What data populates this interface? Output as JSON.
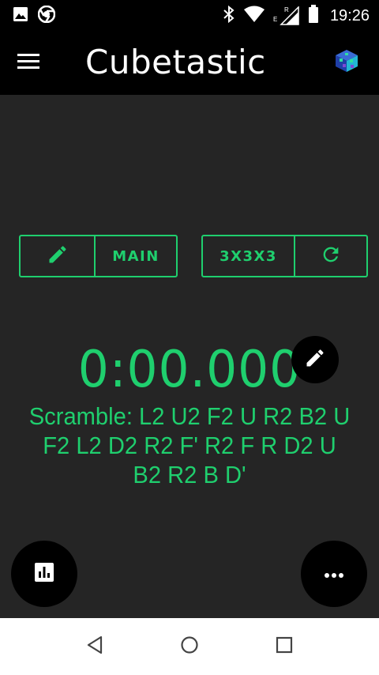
{
  "status_bar": {
    "time": "19:26",
    "icons": [
      "image-icon",
      "chrome-icon",
      "bluetooth-icon",
      "wifi-icon",
      "signal-icon",
      "battery-icon"
    ],
    "network_label_e": "E",
    "network_label_r": "R"
  },
  "app_bar": {
    "title": "Cubetastic",
    "menu_icon": "hamburger-menu-icon",
    "logo_icon": "cube-logo-icon"
  },
  "controls": {
    "session_label": "MAIN",
    "puzzle_label": "3X3X3",
    "edit_icon": "pencil-icon",
    "refresh_icon": "refresh-icon"
  },
  "timer": {
    "display": "0:00.000"
  },
  "scramble": {
    "text": "Scramble: L2 U2 F2 U R2 B2 U F2 L2 D2 R2 F' R2 F R D2 U B2 R2 B D'"
  },
  "fabs": {
    "stats_icon": "bar-chart-icon",
    "more_icon": "more-horizontal-icon"
  },
  "nav_bar": {
    "icons": [
      "back-icon",
      "home-icon",
      "recents-icon"
    ]
  },
  "colors": {
    "accent": "#1fcf6e",
    "background": "#252525",
    "bar": "#000000",
    "nav_bar": "#ffffff"
  }
}
